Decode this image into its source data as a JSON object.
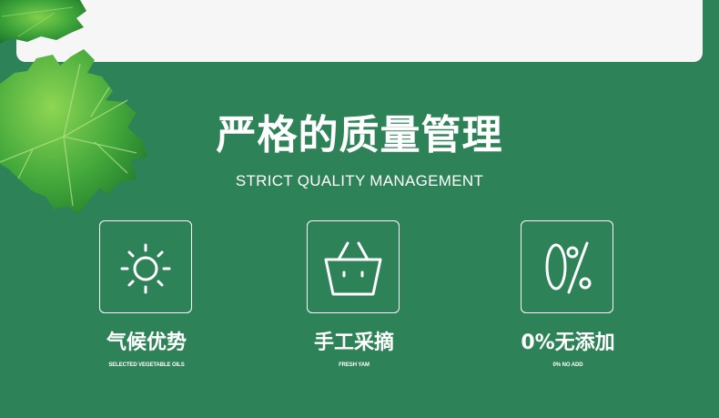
{
  "header": {
    "title": "严格的质量管理",
    "subtitle": "STRICT QUALITY MANAGEMENT"
  },
  "features": [
    {
      "label": "气候优势",
      "sub": "SELECTED VEGETABLE OILS",
      "icon": "sun-icon"
    },
    {
      "label": "手工采摘",
      "sub": "FRESH YAM",
      "icon": "basket-icon"
    },
    {
      "label": "0%无添加",
      "sub": "0% NO ADD",
      "icon": "zero-percent-icon"
    }
  ],
  "colors": {
    "background": "#2e8258",
    "card": "#f6f6f6",
    "leaf": "#3fa53a",
    "text": "#ffffff"
  }
}
